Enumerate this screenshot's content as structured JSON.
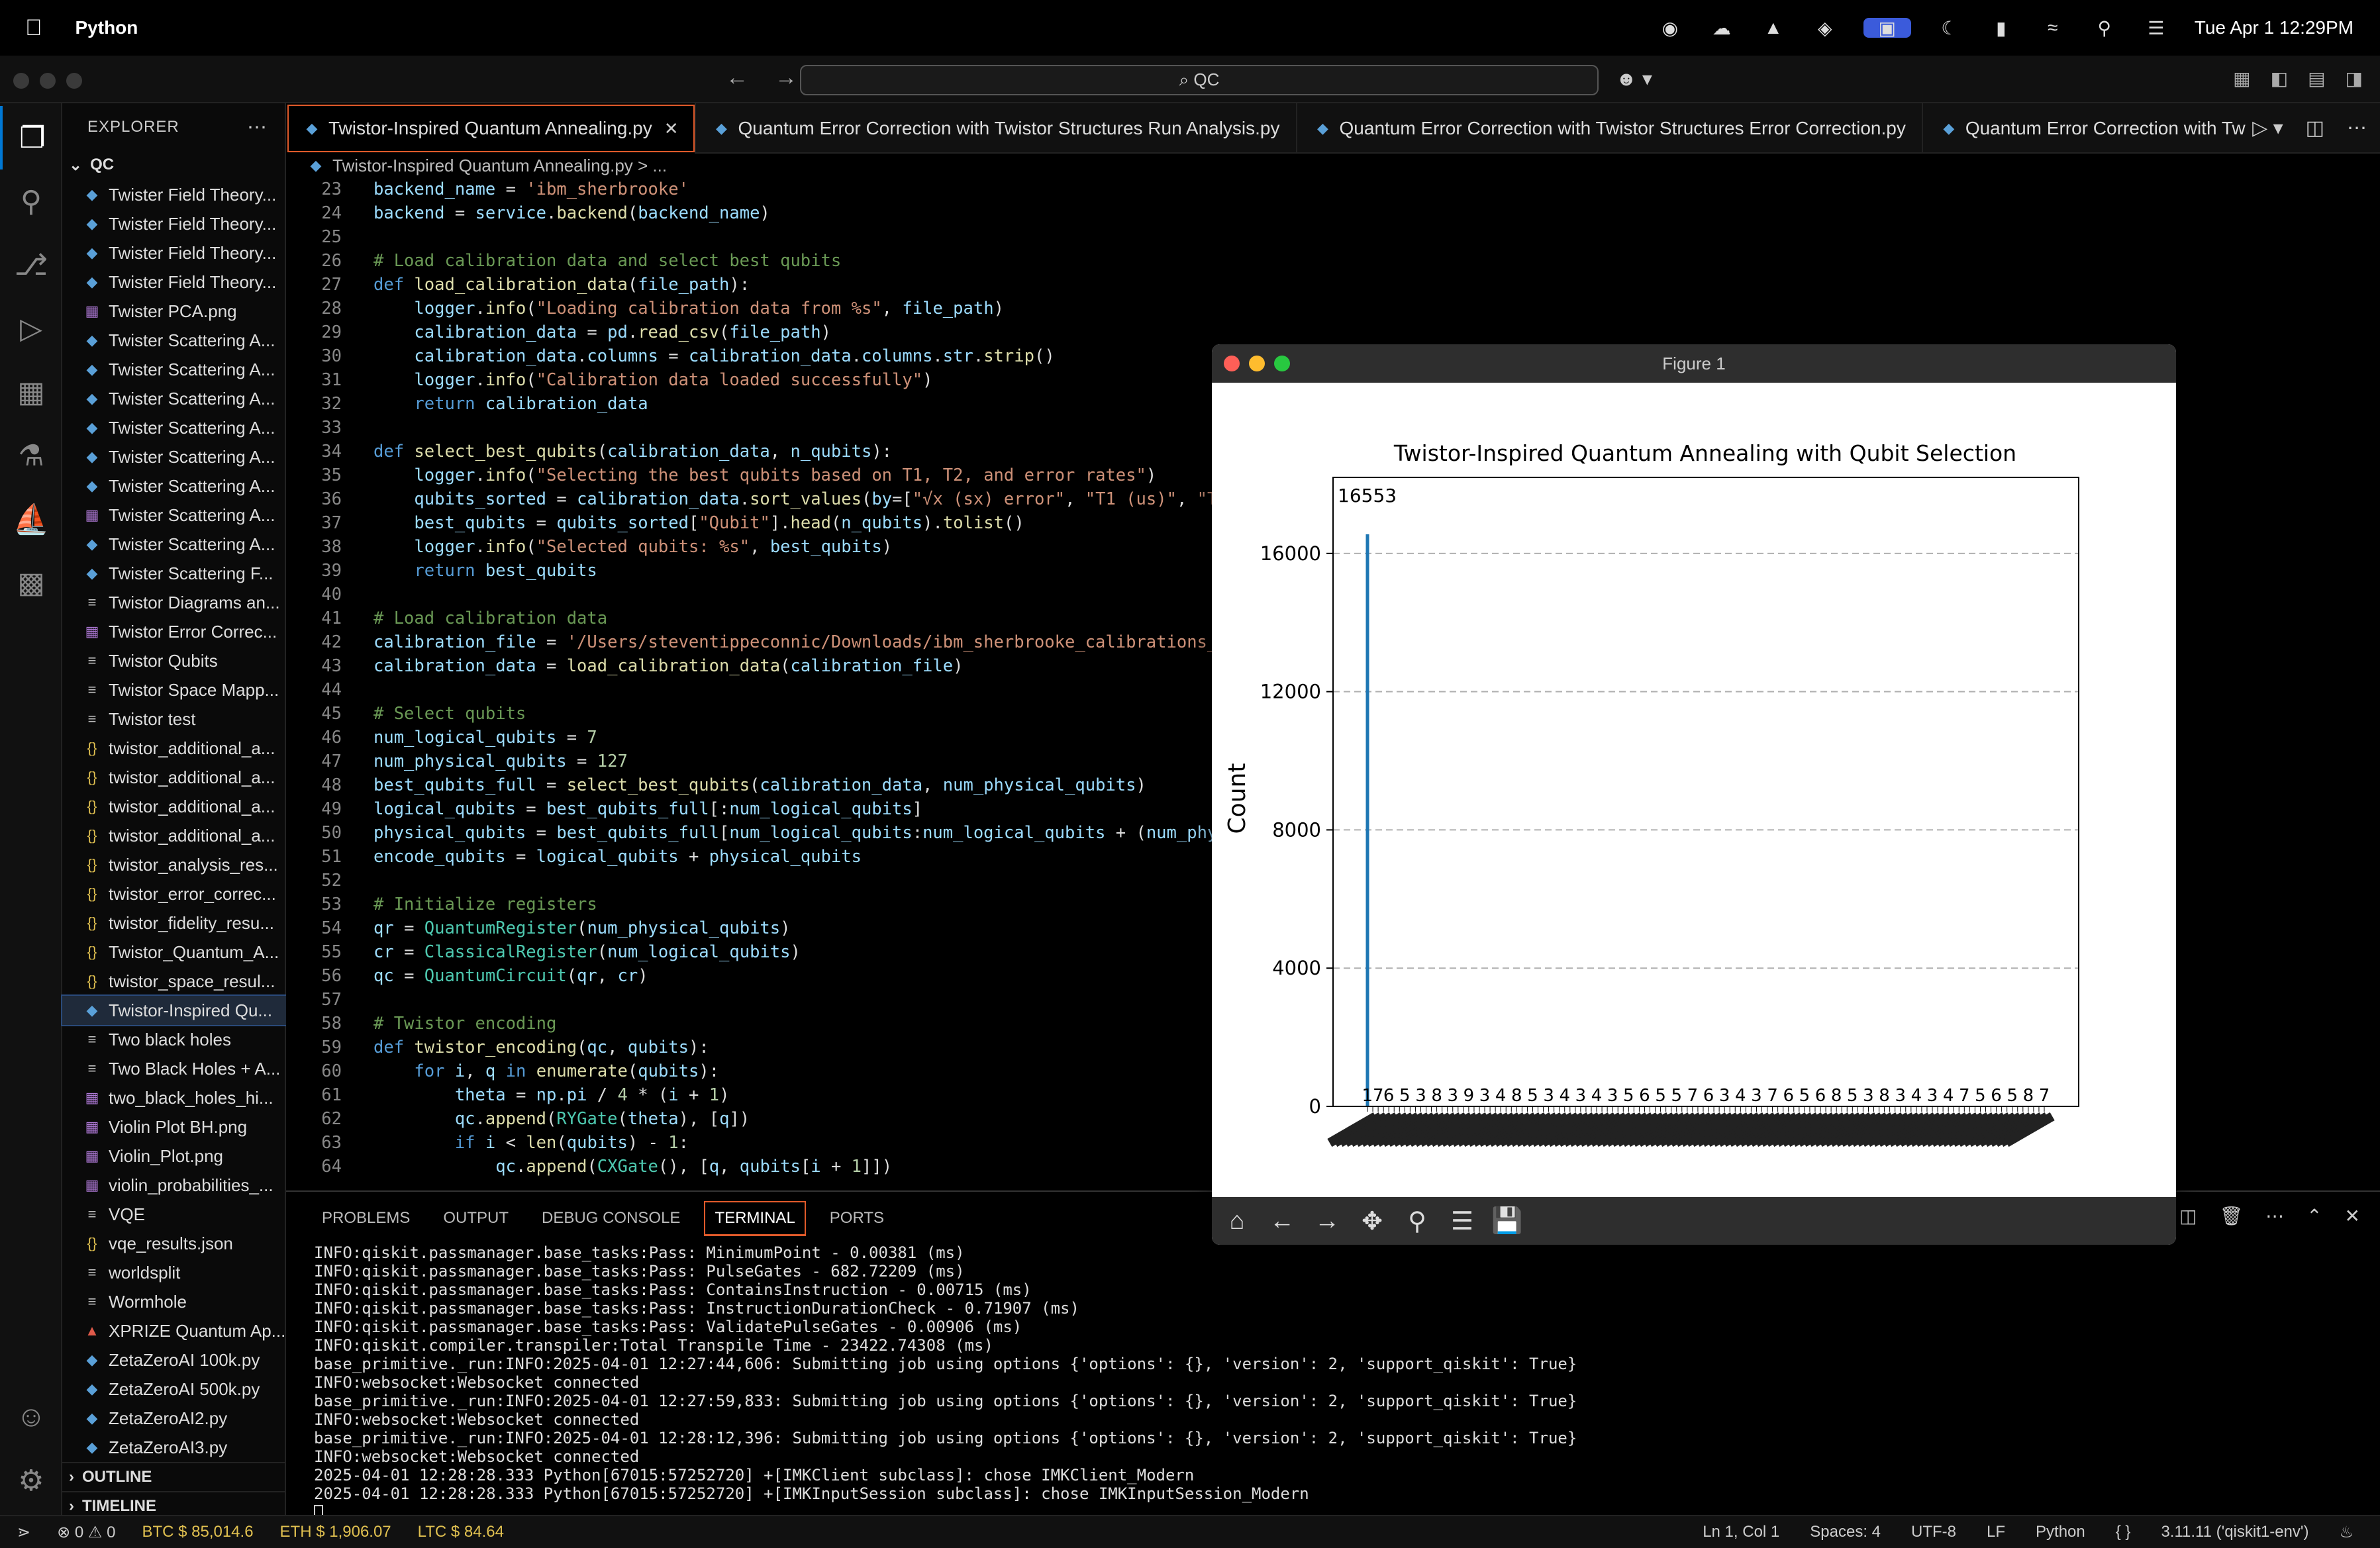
{
  "menubar": {
    "app_name": "Python",
    "datetime": "Tue Apr 1  12:29PM"
  },
  "titlebar": {
    "search_text": "⌕ QC"
  },
  "sidebar": {
    "header": "EXPLORER",
    "folder": "QC",
    "files": [
      {
        "name": "Twister Field Theory...",
        "type": "py"
      },
      {
        "name": "Twister Field Theory...",
        "type": "py"
      },
      {
        "name": "Twister Field Theory...",
        "type": "py"
      },
      {
        "name": "Twister Field Theory...",
        "type": "py"
      },
      {
        "name": "Twister PCA.png",
        "type": "png"
      },
      {
        "name": "Twister Scattering A...",
        "type": "py"
      },
      {
        "name": "Twister Scattering A...",
        "type": "py"
      },
      {
        "name": "Twister Scattering A...",
        "type": "py"
      },
      {
        "name": "Twister Scattering A...",
        "type": "py"
      },
      {
        "name": "Twister Scattering A...",
        "type": "py"
      },
      {
        "name": "Twister Scattering A...",
        "type": "py"
      },
      {
        "name": "Twister Scattering A...",
        "type": "png"
      },
      {
        "name": "Twister Scattering A...",
        "type": "py"
      },
      {
        "name": "Twister Scattering F...",
        "type": "py"
      },
      {
        "name": "Twistor Diagrams an...",
        "type": "txt"
      },
      {
        "name": "Twistor Error Correc...",
        "type": "png"
      },
      {
        "name": "Twistor Qubits",
        "type": "txt"
      },
      {
        "name": "Twistor Space Mapp...",
        "type": "txt"
      },
      {
        "name": "Twistor test",
        "type": "txt"
      },
      {
        "name": "twistor_additional_a...",
        "type": "json"
      },
      {
        "name": "twistor_additional_a...",
        "type": "json"
      },
      {
        "name": "twistor_additional_a...",
        "type": "json"
      },
      {
        "name": "twistor_additional_a...",
        "type": "json"
      },
      {
        "name": "twistor_analysis_res...",
        "type": "json"
      },
      {
        "name": "twistor_error_correc...",
        "type": "json"
      },
      {
        "name": "twistor_fidelity_resu...",
        "type": "json"
      },
      {
        "name": "Twistor_Quantum_A...",
        "type": "json"
      },
      {
        "name": "twistor_space_resul...",
        "type": "json"
      },
      {
        "name": "Twistor-Inspired Qu...",
        "type": "py"
      },
      {
        "name": "Two black holes",
        "type": "txt"
      },
      {
        "name": "Two Black Holes + A...",
        "type": "txt"
      },
      {
        "name": "two_black_holes_hi...",
        "type": "png"
      },
      {
        "name": "Violin Plot BH.png",
        "type": "png"
      },
      {
        "name": "Violin_Plot.png",
        "type": "png"
      },
      {
        "name": "violin_probabilities_...",
        "type": "png"
      },
      {
        "name": "VQE",
        "type": "txt"
      },
      {
        "name": "vqe_results.json",
        "type": "json"
      },
      {
        "name": "worldsplit",
        "type": "txt"
      },
      {
        "name": "Wormhole",
        "type": "txt"
      },
      {
        "name": "XPRIZE Quantum Ap...",
        "type": "pdf"
      },
      {
        "name": "ZetaZeroAI 100k.py",
        "type": "py"
      },
      {
        "name": "ZetaZeroAI 500k.py",
        "type": "py"
      },
      {
        "name": "ZetaZeroAI2.py",
        "type": "py"
      },
      {
        "name": "ZetaZeroAI3.py",
        "type": "py"
      }
    ],
    "outline": "OUTLINE",
    "timeline": "TIMELINE"
  },
  "tabs": [
    {
      "label": "Twistor-Inspired Quantum Annealing.py"
    },
    {
      "label": "Quantum Error Correction with Twistor Structures Run Analysis.py"
    },
    {
      "label": "Quantum Error Correction with Twistor Structures Error Correction.py"
    },
    {
      "label": "Quantum Error Correction with Tw"
    }
  ],
  "breadcrumb": "Twistor-Inspired Quantum Annealing.py > ...",
  "code": [
    {
      "n": "23",
      "t": "backend_name = 'ibm_sherbrooke'"
    },
    {
      "n": "24",
      "t": "backend = service.backend(backend_name)"
    },
    {
      "n": "25",
      "t": ""
    },
    {
      "n": "26",
      "t": "# Load calibration data and select best qubits"
    },
    {
      "n": "27",
      "t": "def load_calibration_data(file_path):"
    },
    {
      "n": "28",
      "t": "    logger.info(\"Loading calibration data from %s\", file_path)"
    },
    {
      "n": "29",
      "t": "    calibration_data = pd.read_csv(file_path)"
    },
    {
      "n": "30",
      "t": "    calibration_data.columns = calibration_data.columns.str.strip()"
    },
    {
      "n": "31",
      "t": "    logger.info(\"Calibration data loaded successfully\")"
    },
    {
      "n": "32",
      "t": "    return calibration_data"
    },
    {
      "n": "33",
      "t": ""
    },
    {
      "n": "34",
      "t": "def select_best_qubits(calibration_data, n_qubits):"
    },
    {
      "n": "35",
      "t": "    logger.info(\"Selecting the best qubits based on T1, T2, and error rates\")"
    },
    {
      "n": "36",
      "t": "    qubits_sorted = calibration_data.sort_values(by=[\"√x (sx) error\", \"T1 (us)\", \"T2 (us"
    },
    {
      "n": "37",
      "t": "    best_qubits = qubits_sorted[\"Qubit\"].head(n_qubits).tolist()"
    },
    {
      "n": "38",
      "t": "    logger.info(\"Selected qubits: %s\", best_qubits)"
    },
    {
      "n": "39",
      "t": "    return best_qubits"
    },
    {
      "n": "40",
      "t": ""
    },
    {
      "n": "41",
      "t": "# Load calibration data"
    },
    {
      "n": "42",
      "t": "calibration_file = '/Users/steventippeconnic/Downloads/ibm_sherbrooke_calibrations_2025-"
    },
    {
      "n": "43",
      "t": "calibration_data = load_calibration_data(calibration_file)"
    },
    {
      "n": "44",
      "t": ""
    },
    {
      "n": "45",
      "t": "# Select qubits"
    },
    {
      "n": "46",
      "t": "num_logical_qubits = 7"
    },
    {
      "n": "47",
      "t": "num_physical_qubits = 127"
    },
    {
      "n": "48",
      "t": "best_qubits_full = select_best_qubits(calibration_data, num_physical_qubits)"
    },
    {
      "n": "49",
      "t": "logical_qubits = best_qubits_full[:num_logical_qubits]"
    },
    {
      "n": "50",
      "t": "physical_qubits = best_qubits_full[num_logical_qubits:num_logical_qubits + (num_physica"
    },
    {
      "n": "51",
      "t": "encode_qubits = logical_qubits + physical_qubits"
    },
    {
      "n": "52",
      "t": ""
    },
    {
      "n": "53",
      "t": "# Initialize registers"
    },
    {
      "n": "54",
      "t": "qr = QuantumRegister(num_physical_qubits)"
    },
    {
      "n": "55",
      "t": "cr = ClassicalRegister(num_logical_qubits)"
    },
    {
      "n": "56",
      "t": "qc = QuantumCircuit(qr, cr)"
    },
    {
      "n": "57",
      "t": ""
    },
    {
      "n": "58",
      "t": "# Twistor encoding"
    },
    {
      "n": "59",
      "t": "def twistor_encoding(qc, qubits):"
    },
    {
      "n": "60",
      "t": "    for i, q in enumerate(qubits):"
    },
    {
      "n": "61",
      "t": "        theta = np.pi / 4 * (i + 1)"
    },
    {
      "n": "62",
      "t": "        qc.append(RYGate(theta), [q])"
    },
    {
      "n": "63",
      "t": "        if i < len(qubits) - 1:"
    },
    {
      "n": "64",
      "t": "            qc.append(CXGate(), [q, qubits[i + 1]])"
    }
  ],
  "panel": {
    "tabs": [
      "PROBLEMS",
      "OUTPUT",
      "DEBUG CONSOLE",
      "TERMINAL",
      "PORTS"
    ],
    "active_tab": "TERMINAL",
    "lines": [
      "INFO:qiskit.passmanager.base_tasks:Pass: MinimumPoint - 0.00381 (ms)",
      "INFO:qiskit.passmanager.base_tasks:Pass: PulseGates - 682.72209 (ms)",
      "INFO:qiskit.passmanager.base_tasks:Pass: ContainsInstruction - 0.00715 (ms)",
      "INFO:qiskit.passmanager.base_tasks:Pass: InstructionDurationCheck - 0.71907 (ms)",
      "INFO:qiskit.passmanager.base_tasks:Pass: ValidatePulseGates - 0.00906 (ms)",
      "INFO:qiskit.compiler.transpiler:Total Transpile Time - 23422.74308 (ms)",
      "base_primitive._run:INFO:2025-04-01 12:27:44,606: Submitting job using options {'options': {}, 'version': 2, 'support_qiskit': True}",
      "INFO:websocket:Websocket connected",
      "base_primitive._run:INFO:2025-04-01 12:27:59,833: Submitting job using options {'options': {}, 'version': 2, 'support_qiskit': True}",
      "INFO:websocket:Websocket connected",
      "base_primitive._run:INFO:2025-04-01 12:28:12,396: Submitting job using options {'options': {}, 'version': 2, 'support_qiskit': True}",
      "INFO:websocket:Websocket connected",
      "2025-04-01 12:28:28.333 Python[67015:57252720] +[IMKClient subclass]: chose IMKClient_Modern",
      "2025-04-01 12:28:28.333 Python[67015:57252720] +[IMKInputSession subclass]: chose IMKInputSession_Modern"
    ]
  },
  "statusbar": {
    "errors": "⊗ 0 ⚠ 0",
    "btc": "BTC $ 85,014.6",
    "eth": "ETH $ 1,906.07",
    "ltc": "LTC $ 84.64",
    "position": "Ln 1, Col 1",
    "spaces": "Spaces: 4",
    "encoding": "UTF-8",
    "eol": "LF",
    "language": "Python",
    "interpreter": "3.11.11 ('qiskit1-env')"
  },
  "figure": {
    "window_title": "Figure 1",
    "chart_data": {
      "type": "bar",
      "title": "Twistor-Inspired Quantum Annealing with Qubit Selection",
      "xlabel": "",
      "ylabel": "Count",
      "ylim": [
        0,
        18200
      ],
      "yticks": [
        0,
        4000,
        8000,
        12000,
        16000
      ],
      "grid": "y-dashed",
      "peak_label": "16553",
      "peak_value": 16553,
      "num_bars": 128,
      "small_bar_values": [
        17,
        14,
        6,
        6,
        4,
        2,
        5,
        6,
        7,
        3,
        5,
        3,
        8,
        6,
        8,
        3,
        6,
        5,
        9,
        5,
        7,
        3,
        6,
        2,
        4,
        6,
        5,
        8,
        3,
        7,
        5,
        4,
        6,
        3,
        5,
        7,
        4,
        6,
        5,
        3,
        8,
        6,
        4,
        5,
        7,
        3,
        6,
        4,
        5,
        8,
        3,
        6,
        7,
        4,
        5,
        3,
        6,
        5,
        8,
        4,
        7,
        3,
        5,
        6,
        4,
        5,
        3,
        7,
        6,
        4,
        8,
        5,
        3,
        6,
        4,
        7,
        5,
        3,
        6,
        8,
        4,
        5,
        7,
        3,
        6,
        5,
        4,
        8,
        3,
        6,
        5,
        7,
        4,
        3,
        6,
        5,
        8,
        4,
        7,
        3,
        5,
        6,
        4,
        5,
        7,
        3,
        6,
        8,
        4,
        5,
        3,
        7,
        6,
        4,
        5,
        8,
        3,
        6,
        7,
        4,
        5,
        3,
        6,
        8,
        5,
        4,
        7
      ]
    }
  }
}
